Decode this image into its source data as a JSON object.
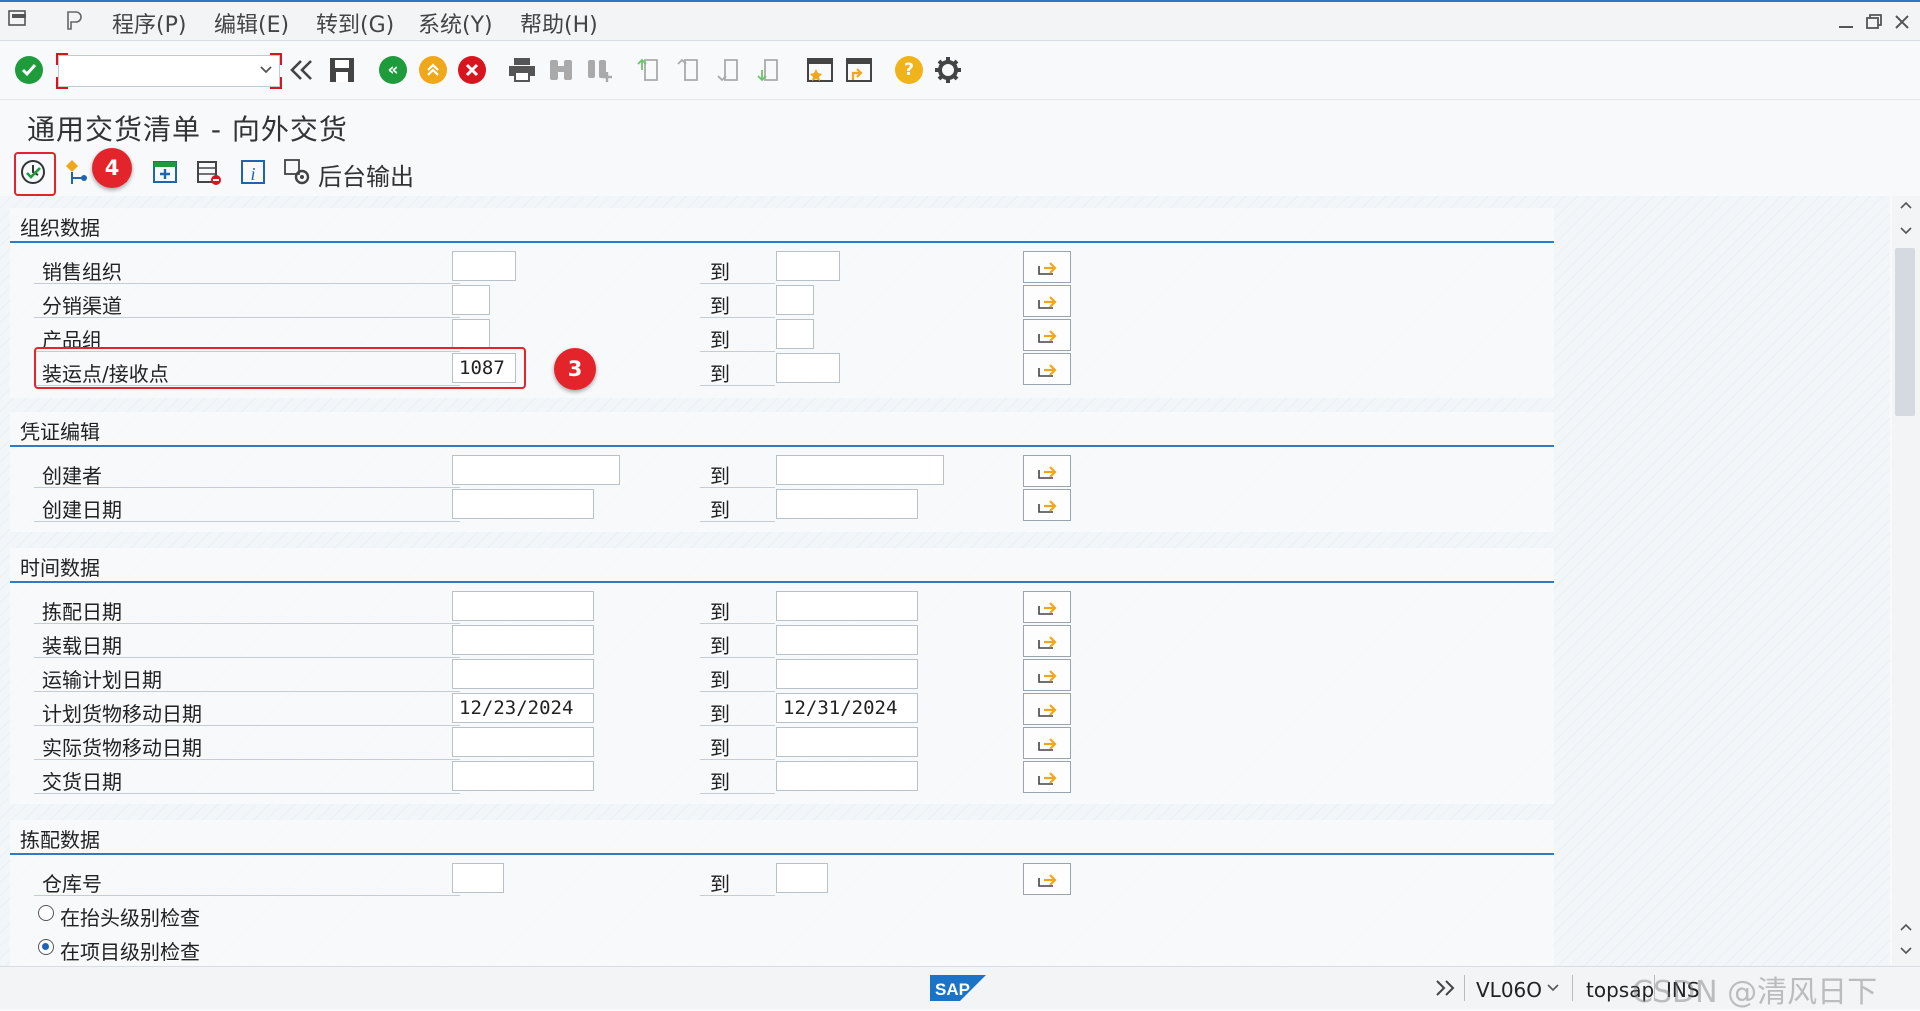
{
  "menu": {
    "items": [
      "程序(P)",
      "编辑(E)",
      "转到(G)",
      "系统(Y)",
      "帮助(H)"
    ]
  },
  "title": "通用交货清单 - 向外交货",
  "app_toolbar": {
    "background_output_label": "后台输出"
  },
  "badges": {
    "step3": "3",
    "step4": "4"
  },
  "range_to_label": "到",
  "groups": {
    "org": {
      "title": "组织数据",
      "rows": [
        {
          "label": "销售组织",
          "from": "",
          "to": ""
        },
        {
          "label": "分销渠道",
          "from": "",
          "to": ""
        },
        {
          "label": "产品组",
          "from": "",
          "to": ""
        },
        {
          "label": "装运点/接收点",
          "from": "1087",
          "to": ""
        }
      ]
    },
    "doc": {
      "title": "凭证编辑",
      "rows": [
        {
          "label": "创建者",
          "from": "",
          "to": ""
        },
        {
          "label": "创建日期",
          "from": "",
          "to": ""
        }
      ]
    },
    "time": {
      "title": "时间数据",
      "rows": [
        {
          "label": "拣配日期",
          "from": "",
          "to": ""
        },
        {
          "label": "装载日期",
          "from": "",
          "to": ""
        },
        {
          "label": "运输计划日期",
          "from": "",
          "to": ""
        },
        {
          "label": "计划货物移动日期",
          "from": "12/23/2024",
          "to": "12/31/2024"
        },
        {
          "label": "实际货物移动日期",
          "from": "",
          "to": ""
        },
        {
          "label": "交货日期",
          "from": "",
          "to": ""
        }
      ]
    },
    "pick": {
      "title": "拣配数据",
      "rows": [
        {
          "label": "仓库号",
          "from": "",
          "to": ""
        }
      ],
      "radio_header": "在抬头级别检查",
      "radio_item": "在项目级别检查",
      "radio_selected": "item"
    }
  },
  "statusbar": {
    "transaction": "VL06O",
    "server": "topsap",
    "mode": "INS",
    "watermark": "CSDN @清风日下"
  },
  "colors": {
    "accent": "#2a7bc8",
    "annotation_red": "#e3242b",
    "ok_green": "#1e9c3c",
    "cancel_red": "#d8141e",
    "exit_orange": "#f0a81a"
  }
}
